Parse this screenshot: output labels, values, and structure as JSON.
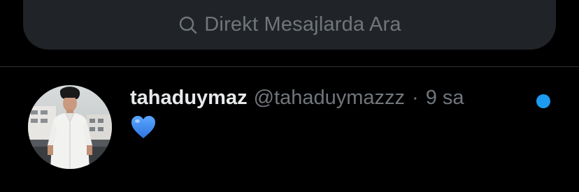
{
  "search": {
    "placeholder": "Direkt Mesajlarda Ara",
    "icon": "search-icon"
  },
  "conversation": {
    "display_name": "tahaduymaz",
    "handle": "@tahaduymazzz",
    "separator": "·",
    "timestamp": "9 sa",
    "last_message_icon": "blue-heart-icon",
    "unread": true
  },
  "colors": {
    "background": "#000000",
    "search_bg": "#202327",
    "muted_text": "#71767b",
    "primary_text": "#e7e9ea",
    "unread_accent": "#1d9bf0",
    "heart_blue": "#3d8bf2",
    "divider": "#2f3336"
  }
}
